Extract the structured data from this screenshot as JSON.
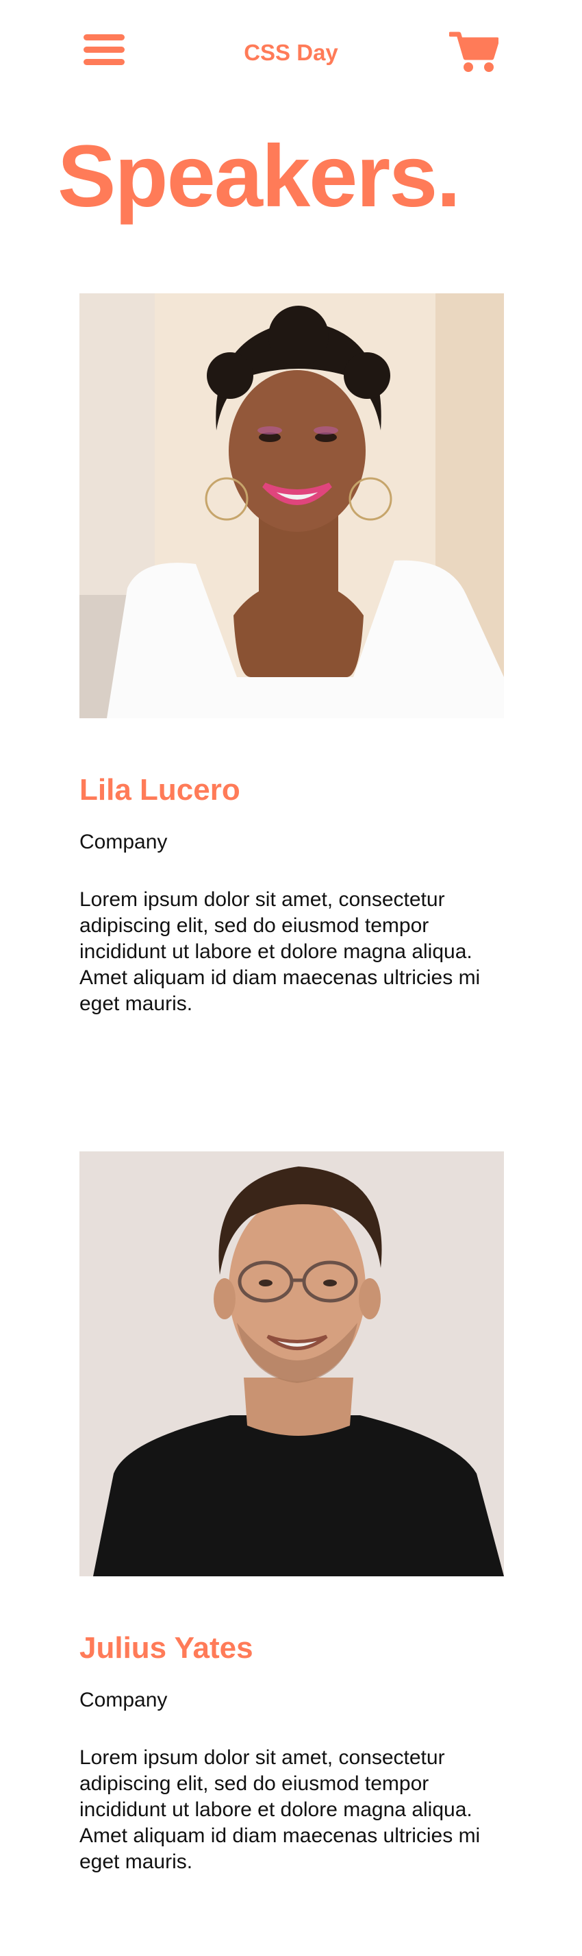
{
  "header": {
    "menu_icon": "hamburger-menu-icon",
    "title": "CSS Day",
    "cart_icon": "shopping-cart-icon",
    "accent_color": "#ff7b58"
  },
  "page": {
    "title": "Speakers."
  },
  "speakers": [
    {
      "name": "Lila Lucero",
      "company": "Company",
      "bio": "Lorem ipsum dolor sit amet, consectetur adipiscing elit, sed do eiusmod tempor incididunt ut labore et dolore magna aliqua. Amet aliquam id diam maecenas ultricies mi eget mauris."
    },
    {
      "name": "Julius Yates",
      "company": "Company",
      "bio": "Lorem ipsum dolor sit amet, consectetur adipiscing elit, sed do eiusmod tempor incididunt ut labore et dolore magna aliqua. Amet aliquam id diam maecenas ultricies mi eget mauris."
    }
  ]
}
